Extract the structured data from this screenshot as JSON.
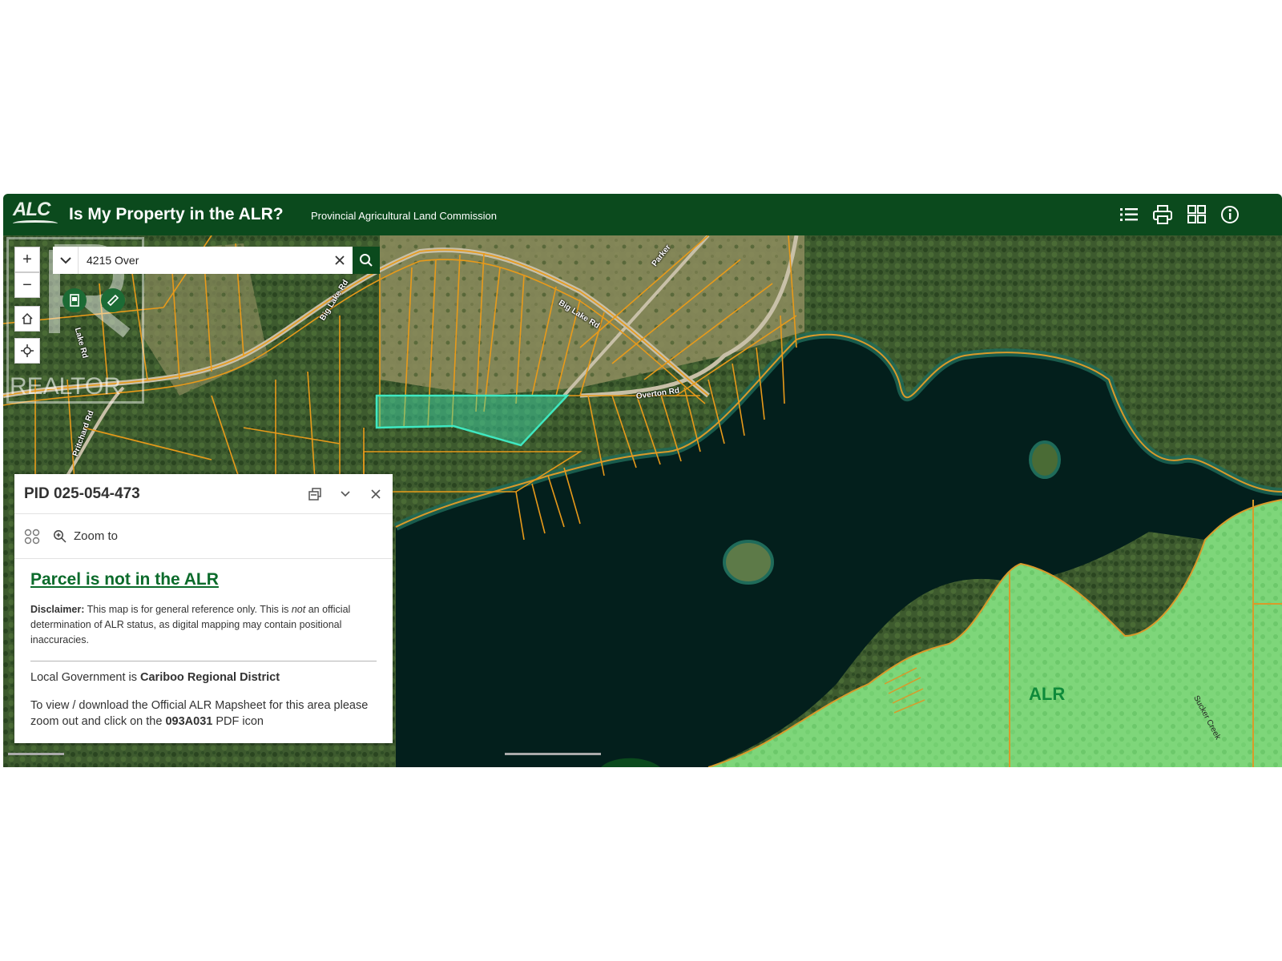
{
  "header": {
    "logo": "ALC",
    "title": "Is My Property in the ALR?",
    "subtitle": "Provincial Agricultural Land Commission",
    "icons": [
      "list-icon",
      "print-icon",
      "grid-icon",
      "info-icon"
    ]
  },
  "search": {
    "value": "4215 Over"
  },
  "map_controls": [
    "zoom-in",
    "zoom-out",
    "home",
    "locate"
  ],
  "watermark": "REALTOR",
  "roads": [
    "Big Lake Rd",
    "Big Lake Rd",
    "Parker",
    "Overton Rd",
    "Pritchard Rd",
    "Lake Rd",
    "Sucker Creek"
  ],
  "map_label": "ALR",
  "popup": {
    "title": "PID 025-054-473",
    "zoom_label": "Zoom to",
    "status": "Parcel is not in the ALR",
    "disclaimer_bold": "Disclaimer:",
    "disclaimer_a": " This map is for general reference only. This is ",
    "disclaimer_em": "not",
    "disclaimer_b": " an official determination of ALR status, as digital mapping may contain positional inaccuracies.",
    "local_gov_prefix": "Local Government is ",
    "local_gov": "Cariboo Regional District",
    "mapsheet_a": "To view / download the Official ALR Mapsheet for this area please zoom out and click on the ",
    "mapsheet_code": "093A031",
    "mapsheet_b": " PDF icon"
  },
  "colors": {
    "header": "#0b4a1d",
    "parcel_lines": "#e89a1a",
    "alr_fill": "#7fd97a",
    "selected_parcel": "#3fe0b0",
    "lake": "#031f1c"
  }
}
